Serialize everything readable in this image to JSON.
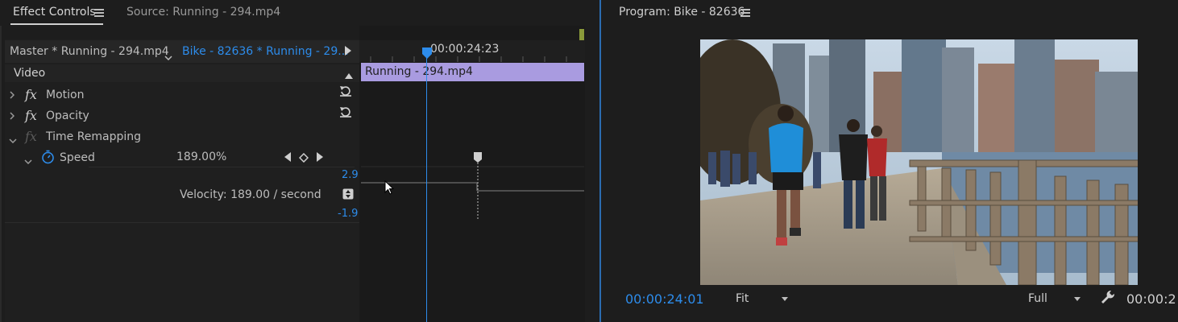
{
  "tabs": {
    "effect_controls": "Effect Controls",
    "source": "Source: Running - 294.mp4",
    "program": "Program: Bike - 82636"
  },
  "effect_controls": {
    "master_clip": "Master * Running - 294.mp4",
    "sequence_clip": "Bike - 82636 * Running - 29...",
    "timecode": "00:00:24:23",
    "clip_name": "Running - 294.mp4",
    "section_video": "Video",
    "effects": [
      {
        "name": "Motion"
      },
      {
        "name": "Opacity"
      },
      {
        "name": "Time Remapping"
      }
    ],
    "speed": {
      "label": "Speed",
      "value": "189.00%",
      "graph_max": "2.9",
      "graph_min": "-1.9",
      "velocity": "Velocity: 189.00 / second"
    }
  },
  "program": {
    "timecode": "00:00:24:01",
    "zoom": "Fit",
    "resolution": "Full",
    "end_timecode": "00:00:2"
  },
  "colors": {
    "accent": "#2d8ceb",
    "clip": "#a99be0",
    "keyframe_end": "#8a9a3a"
  },
  "icons": {
    "menu": "hamburger-icon",
    "reset": "reset-icon",
    "stopwatch": "stopwatch-icon",
    "wrench": "wrench-icon"
  }
}
